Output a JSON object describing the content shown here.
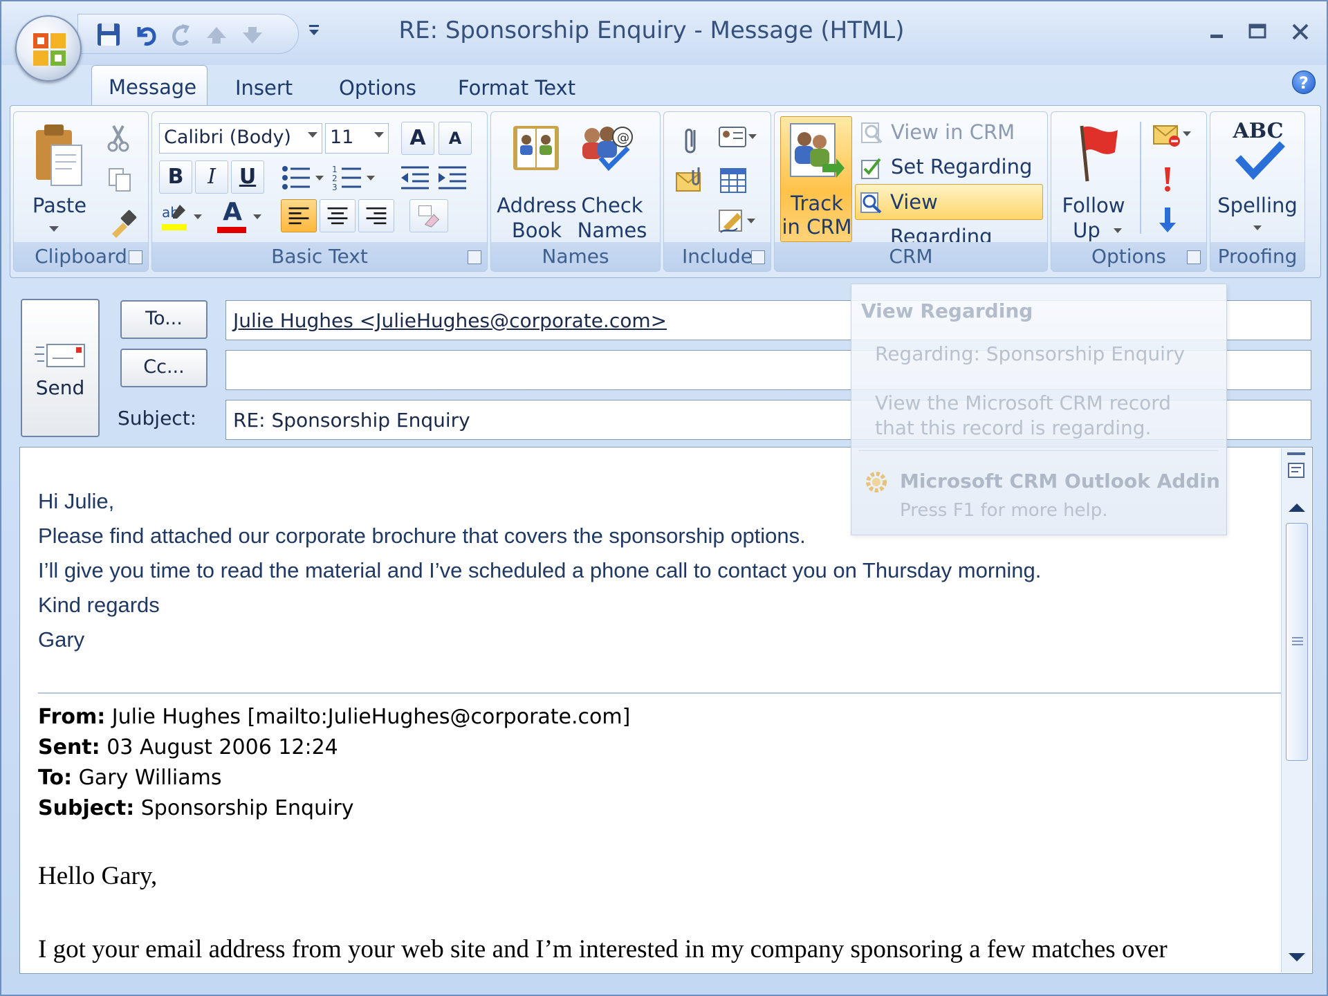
{
  "window": {
    "title": "RE: Sponsorship Enquiry - Message (HTML)",
    "minimize": "–",
    "maximize": "▭",
    "close": "✕"
  },
  "tabs": [
    "Message",
    "Insert",
    "Options",
    "Format Text"
  ],
  "help": "?",
  "ribbon": {
    "clipboard": {
      "label": "Clipboard",
      "paste": "Paste"
    },
    "basic_text": {
      "label": "Basic Text",
      "font": "Calibri (Body)",
      "size": "11",
      "bold": "B",
      "italic": "I",
      "underline": "U",
      "grow": "A",
      "shrink": "A",
      "font_color": "A"
    },
    "names": {
      "label": "Names",
      "address_book_1": "Address",
      "address_book_2": "Book",
      "check_names_1": "Check",
      "check_names_2": "Names"
    },
    "include": {
      "label": "Include"
    },
    "crm": {
      "label": "CRM",
      "track_1": "Track",
      "track_2": "in CRM",
      "view_in_crm": "View in CRM",
      "set_regarding": "Set Regarding",
      "view_regarding": "View Regarding"
    },
    "options": {
      "label": "Options",
      "follow_up_1": "Follow",
      "follow_up_2": "Up"
    },
    "proofing": {
      "label": "Proofing",
      "spelling": "Spelling",
      "abc": "ABC"
    }
  },
  "header": {
    "send": "Send",
    "to_button": "To...",
    "cc_button": "Cc...",
    "subject_label": "Subject:",
    "to_value": "Julie Hughes <JulieHughes@corporate.com>",
    "cc_value": "",
    "subject_value": "RE: Sponsorship Enquiry"
  },
  "body": {
    "greeting": "Hi Julie,",
    "line1": "Please find attached our corporate brochure that covers the sponsorship options.",
    "line2": "I’ll give you time to read the material and I’ve scheduled a phone call to contact you on Thursday morning.",
    "line3": "Kind regards",
    "line4": "Gary",
    "from_label": "From:",
    "from_value": "Julie Hughes [mailto:JulieHughes@corporate.com]",
    "sent_label": "Sent:",
    "sent_value": "03 August 2006 12:24",
    "to_label": "To:",
    "to_value": "Gary Williams",
    "subject_label": "Subject:",
    "subject_value": "Sponsorship Enquiry",
    "quoted_greeting": "Hello Gary,",
    "quoted_line1": "I got your email address from your web site and I’m interested in my company sponsoring a few matches over"
  },
  "tooltip": {
    "title": "View Regarding",
    "regarding": "Regarding: Sponsorship Enquiry",
    "description": "View the Microsoft CRM record that this record is regarding.",
    "addin": "Microsoft CRM Outlook Addin",
    "help": "Press F1 for more help."
  },
  "colors": {
    "accent": "#ffc24a",
    "ribbon_text": "#1e3a6b",
    "body_text": "#1f3864"
  }
}
